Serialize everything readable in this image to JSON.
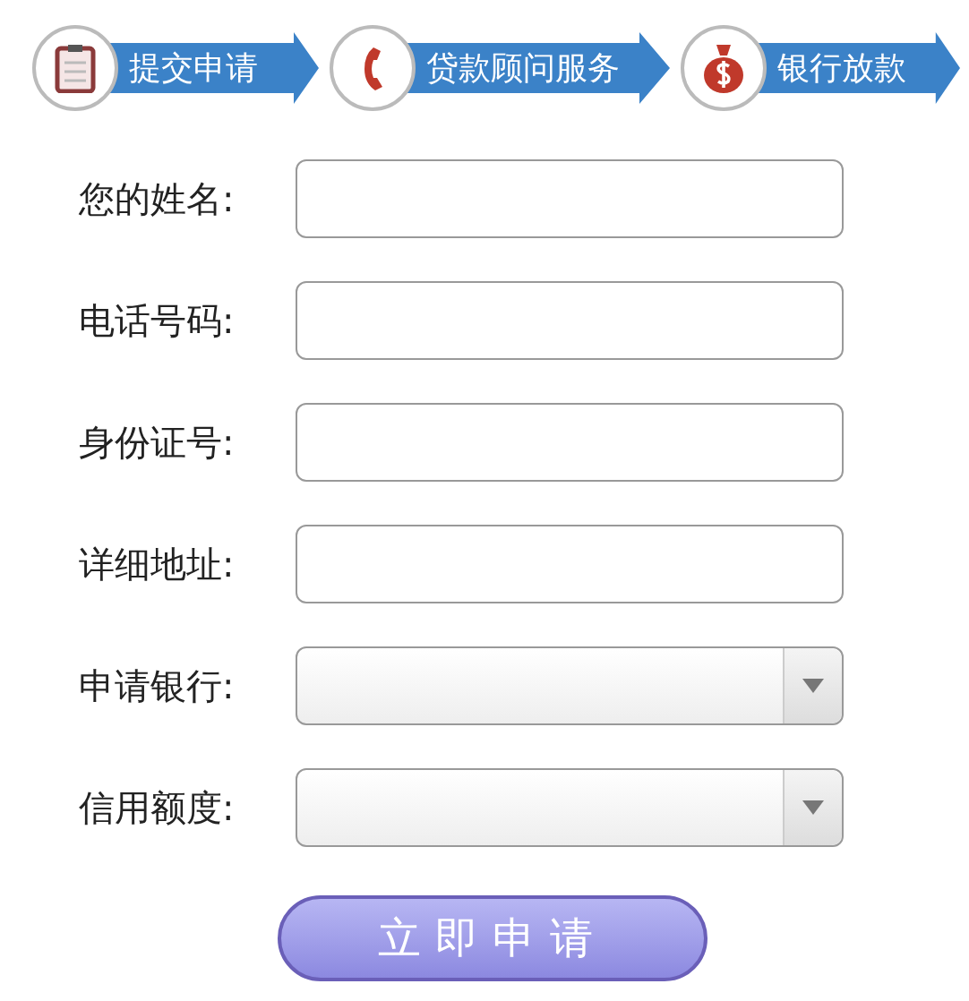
{
  "steps": [
    {
      "label": "提交申请",
      "kind": "clipboard"
    },
    {
      "label": "贷款顾问服务",
      "kind": "phone"
    },
    {
      "label": "银行放款",
      "kind": "moneybag"
    }
  ],
  "form": {
    "fields": [
      {
        "label": "您的姓名:",
        "kind": "text"
      },
      {
        "label": "电话号码:",
        "kind": "text"
      },
      {
        "label": "身份证号:",
        "kind": "text"
      },
      {
        "label": "详细地址:",
        "kind": "text"
      },
      {
        "label": "申请银行:",
        "kind": "select"
      },
      {
        "label": "信用额度:",
        "kind": "select"
      }
    ],
    "submit": "立即申请"
  }
}
